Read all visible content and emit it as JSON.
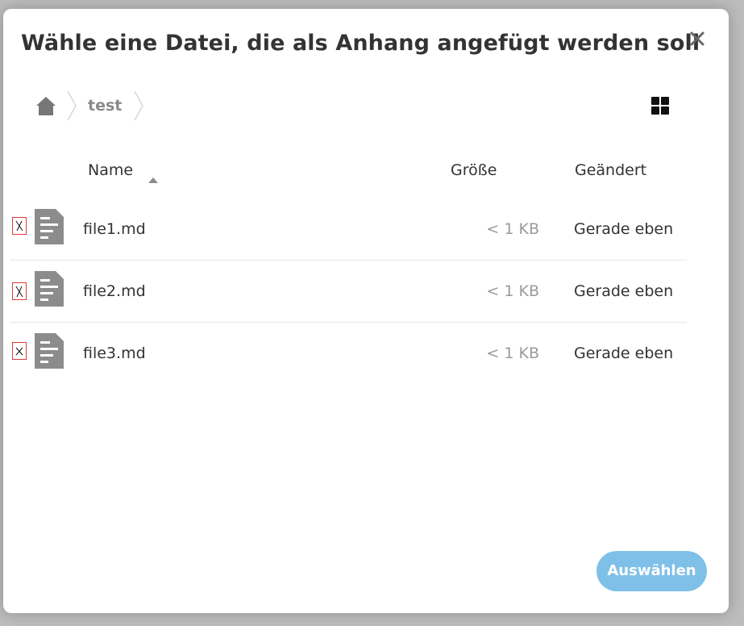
{
  "dialog": {
    "title": "Wähle eine Datei, die als Anhang angefügt werden soll",
    "close_icon": "close-icon"
  },
  "breadcrumb": {
    "home_icon": "home-icon",
    "items": [
      {
        "label": "test"
      }
    ]
  },
  "view_toggle_icon": "grid-view-icon",
  "table": {
    "columns": {
      "name": "Name",
      "size": "Größe",
      "modified": "Geändert"
    },
    "sort": {
      "column": "Name",
      "direction": "ascending"
    },
    "rows": [
      {
        "name": "file1.md",
        "size": "< 1 KB",
        "modified": "Gerade eben",
        "icon": "document-icon"
      },
      {
        "name": "file2.md",
        "size": "< 1 KB",
        "modified": "Gerade eben",
        "icon": "document-icon"
      },
      {
        "name": "file3.md",
        "size": "< 1 KB",
        "modified": "Gerade eben",
        "icon": "document-icon"
      }
    ]
  },
  "actions": {
    "choose_label": "Auswählen"
  },
  "colors": {
    "primary_button": "#7fc0e8",
    "text": "#333333",
    "muted_text": "#9a9a9a",
    "icon": "#8c8c8c",
    "checkbox_border": "#e03a3a"
  }
}
